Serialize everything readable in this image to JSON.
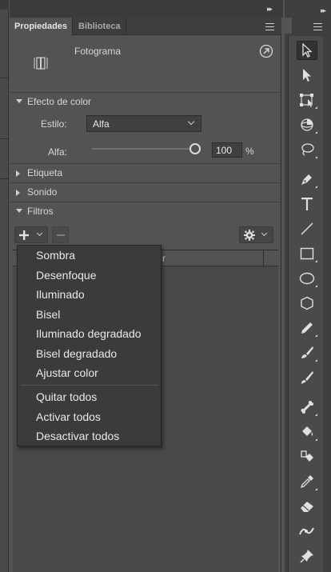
{
  "tabs": {
    "propiedades": "Propiedades",
    "biblioteca": "Biblioteca"
  },
  "document": {
    "type_label": "Fotograma"
  },
  "color_effect": {
    "header": "Efecto de color",
    "style_label": "Estilo:",
    "style_value": "Alfa",
    "alpha_label": "Alfa:",
    "alpha_value": "100",
    "alpha_unit": "%",
    "alpha_level": 1.0
  },
  "sections": {
    "etiqueta": "Etiqueta",
    "sonido": "Sonido",
    "filtros": "Filtros"
  },
  "filters_table": {
    "column_partial": "r"
  },
  "add_filter_menu": {
    "items": [
      "Sombra",
      "Desenfoque",
      "Iluminado",
      "Bisel",
      "Iluminado degradado",
      "Bisel degradado",
      "Ajustar color"
    ],
    "actions": [
      "Quitar todos",
      "Activar todos",
      "Desactivar todos"
    ]
  },
  "tools": [
    "selection-tool-icon",
    "subselection-tool-icon",
    "free-transform-tool-icon",
    "3d-rotation-tool-icon",
    "lasso-tool-icon",
    "pen-tool-icon",
    "text-tool-icon",
    "line-tool-icon",
    "rectangle-tool-icon",
    "oval-tool-icon",
    "polystar-tool-icon",
    "pencil-tool-icon",
    "paint-brush-tool-icon",
    "brush-tool-icon",
    "bone-tool-icon",
    "paint-bucket-tool-icon",
    "ink-bottle-tool-icon",
    "eyedropper-tool-icon",
    "eraser-tool-icon",
    "width-tool-icon",
    "pin-tool-icon"
  ],
  "colors": {
    "panel_bg": "#535353",
    "menu_bg": "#3b3b3b",
    "toolbar_bg": "#4a4a4a"
  }
}
